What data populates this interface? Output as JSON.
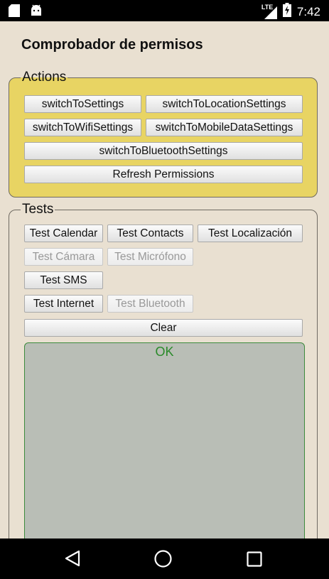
{
  "status": {
    "time": "7:42",
    "network": "LTE",
    "left_icons": [
      "sd-card-icon",
      "android-icon"
    ]
  },
  "app": {
    "title": "Comprobador de permisos",
    "actions": {
      "legend": "Actions",
      "buttons": {
        "switch_to_settings": "switchToSettings",
        "switch_to_location": "switchToLocationSettings",
        "switch_to_wifi": "switchToWifiSettings",
        "switch_to_mobile_data": "switchToMobileDataSettings",
        "switch_to_bluetooth": "switchToBluetoothSettings",
        "refresh": "Refresh Permissions"
      }
    },
    "tests": {
      "legend": "Tests",
      "buttons": {
        "calendar": "Test Calendar",
        "contacts": "Test Contacts",
        "location": "Test Localización",
        "camera": "Test Cámara",
        "microphone": "Test Micrófono",
        "sms": "Test SMS",
        "internet": "Test Internet",
        "bluetooth": "Test Bluetooth",
        "clear": "Clear"
      },
      "disabled": [
        "camera",
        "microphone",
        "bluetooth"
      ],
      "output": "OK"
    }
  },
  "colors": {
    "actions_bg": "#e8d463",
    "app_bg": "#e9e0d1",
    "output_bg": "#b9beb6",
    "output_text": "#2a8a2a"
  },
  "nav": {
    "icons": [
      "back-icon",
      "home-icon",
      "recents-icon"
    ]
  }
}
